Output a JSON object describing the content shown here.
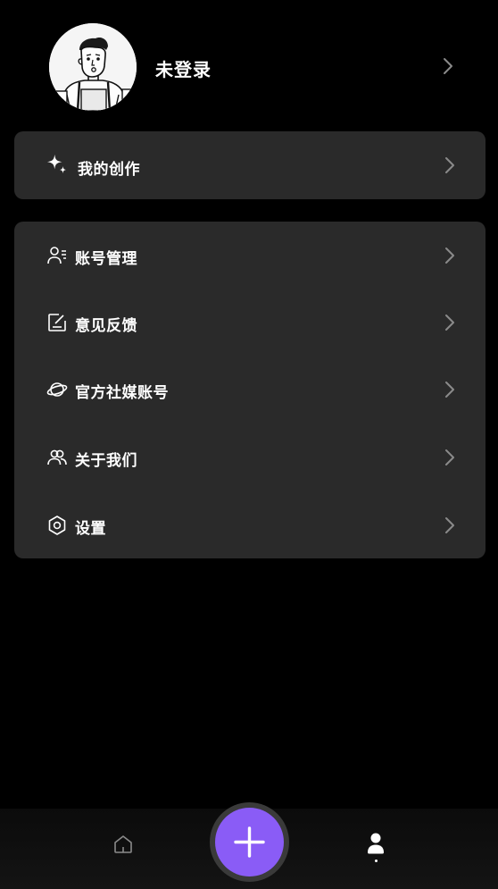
{
  "profile": {
    "name": "未登录"
  },
  "creation": {
    "label": "我的创作"
  },
  "menu": {
    "items": [
      {
        "label": "账号管理",
        "icon": "user-list-icon"
      },
      {
        "label": "意见反馈",
        "icon": "feedback-edit-icon"
      },
      {
        "label": "官方社媒账号",
        "icon": "planet-icon"
      },
      {
        "label": "关于我们",
        "icon": "group-icon"
      },
      {
        "label": "设置",
        "icon": "hexagon-settings-icon"
      }
    ]
  },
  "tabbar": {
    "tabs": [
      {
        "name": "home",
        "icon": "home-icon",
        "active": false
      },
      {
        "name": "create",
        "icon": "plus-icon"
      },
      {
        "name": "me",
        "icon": "person-icon",
        "active": true
      }
    ]
  },
  "colors": {
    "background": "#000000",
    "card": "#2a2a2a",
    "accent": "#8a5cf6",
    "text": "#ffffff",
    "muted": "#8a8a8a"
  }
}
